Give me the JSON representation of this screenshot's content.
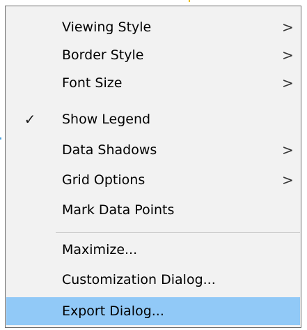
{
  "menu": {
    "items": [
      {
        "label": "Viewing Style",
        "submenu_glyph": ">"
      },
      {
        "label": "Border Style",
        "submenu_glyph": ">"
      },
      {
        "label": "Font Size",
        "submenu_glyph": ">"
      },
      {
        "label": "Show Legend",
        "checked_glyph": "✓",
        "checked": true
      },
      {
        "label": "Data Shadows",
        "submenu_glyph": ">"
      },
      {
        "label": "Grid Options",
        "submenu_glyph": ">"
      },
      {
        "label": "Mark Data Points"
      },
      {
        "label": "Maximize..."
      },
      {
        "label": "Customization Dialog..."
      },
      {
        "label": "Export Dialog...",
        "highlighted": true
      }
    ]
  },
  "colors": {
    "menu_background": "#f2f2f2",
    "highlight": "#91c9f7",
    "border": "#6e6e6e",
    "separator": "#c8c8c8"
  }
}
